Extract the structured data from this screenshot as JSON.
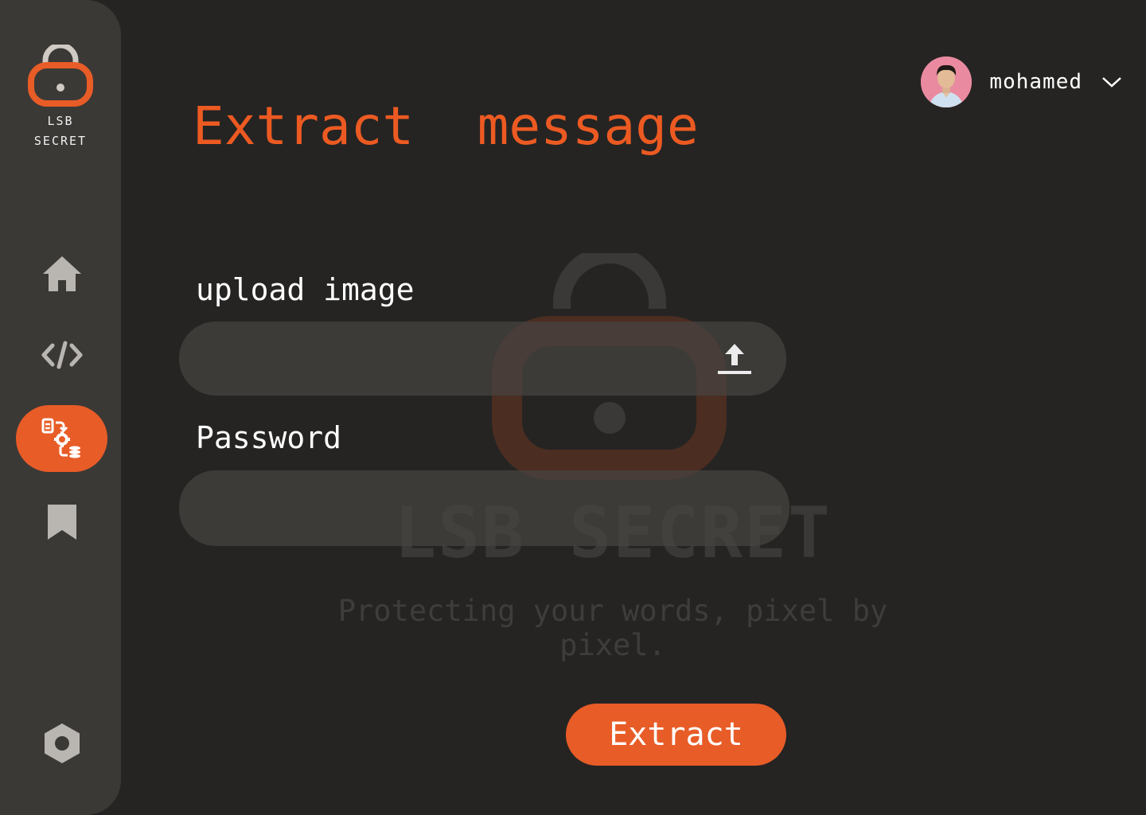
{
  "brand": {
    "logo_text": "LSB\nSECRET"
  },
  "sidebar": {
    "items": [
      {
        "icon": "home-icon"
      },
      {
        "icon": "code-icon"
      },
      {
        "icon": "extract-data-icon",
        "active": true
      },
      {
        "icon": "bookmark-icon"
      },
      {
        "icon": "settings-hexagon-icon"
      }
    ]
  },
  "header": {
    "title": "Extract  message"
  },
  "user": {
    "name": "mohamed",
    "avatar": "user-avatar"
  },
  "form": {
    "upload_label": "upload image",
    "upload_placeholder": "",
    "password_label": "Password",
    "password_placeholder": "",
    "submit_label": "Extract"
  },
  "watermark": {
    "title": "LSB SECRET",
    "tagline": "Protecting your words, pixel by pixel."
  },
  "colors": {
    "accent": "#e85c27",
    "title": "#ec5a22",
    "background": "#252423",
    "sidebar": "#3b3936",
    "field": "#464441"
  }
}
